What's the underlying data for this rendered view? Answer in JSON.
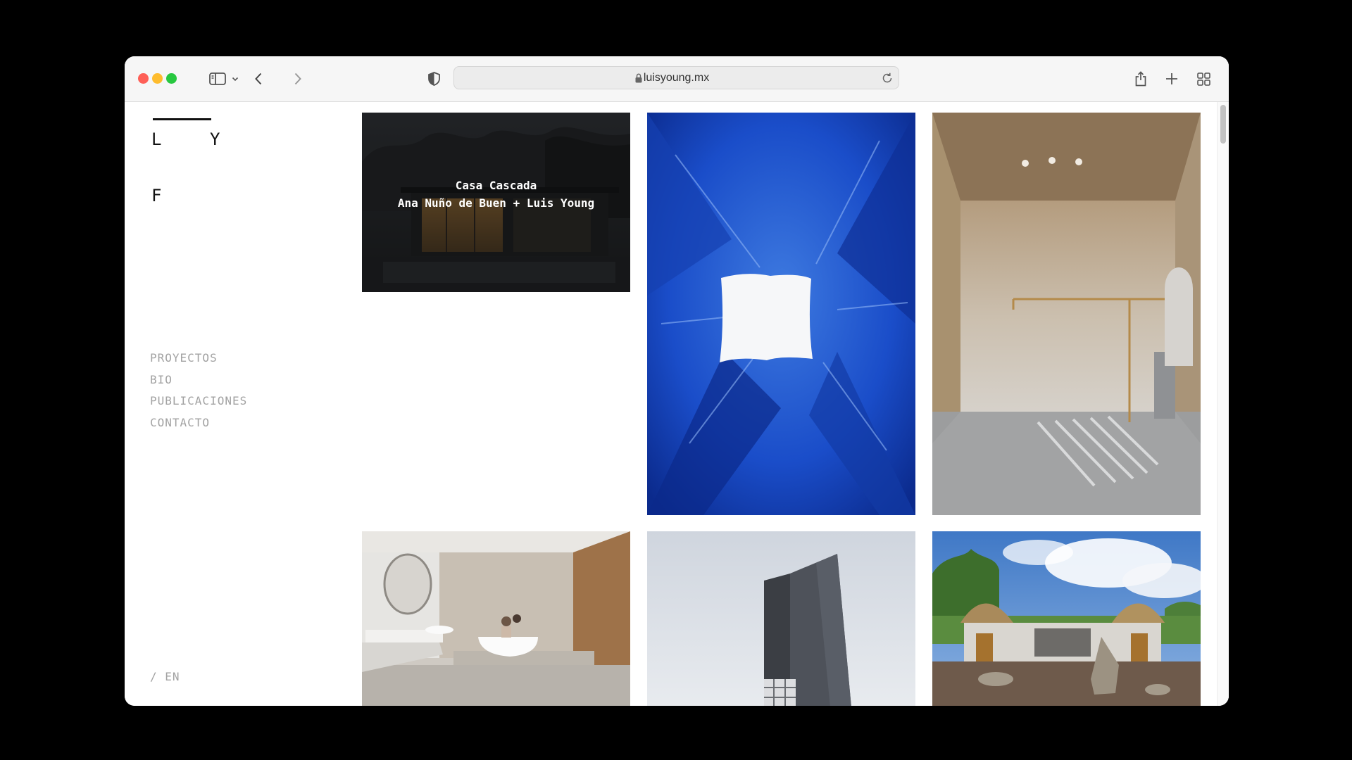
{
  "browser": {
    "url": "luisyoung.mx",
    "traffic_lights": {
      "close": "#fe5f57",
      "minimize": "#febc2e",
      "zoom": "#28c840"
    },
    "icons": [
      "sidebar-toggle-icon",
      "chevron-down-icon",
      "back-arrow-icon",
      "forward-arrow-icon",
      "privacy-shield-icon",
      "lock-icon",
      "reload-icon",
      "share-icon",
      "plus-icon",
      "tab-overview-icon"
    ]
  },
  "site": {
    "logo": {
      "l": "L",
      "y": "Y",
      "f": "F"
    },
    "nav": [
      {
        "label": "PROYECTOS"
      },
      {
        "label": "BIO"
      },
      {
        "label": "PUBLICACIONES"
      },
      {
        "label": "CONTACTO"
      }
    ],
    "lang_switch": "/ EN"
  },
  "gallery": {
    "projects": [
      {
        "title": "Casa Cascada",
        "authors": "Ana Nuño de Buen + Luis Young",
        "image": "night-house-photo"
      },
      {
        "image": "blue-sculpture-photo"
      },
      {
        "image": "beige-interior-photo"
      },
      {
        "image": "bathroom-photo"
      },
      {
        "image": "tower-photo"
      },
      {
        "image": "palapa-house-photo"
      }
    ]
  },
  "colors": {
    "nav_text": "#a2a2a2",
    "logo": "#111111"
  }
}
